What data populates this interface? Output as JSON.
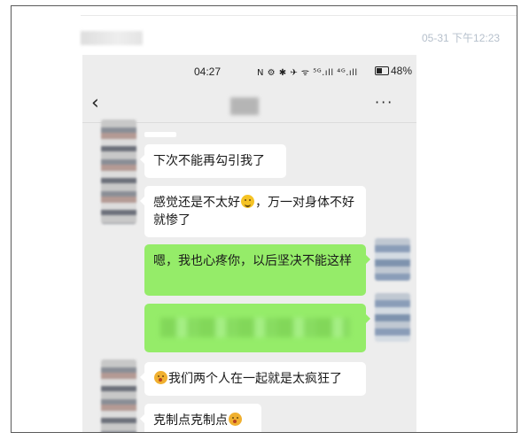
{
  "post": {
    "time": "05-31 下午12:23"
  },
  "phone": {
    "status_time": "04:27",
    "status_icons": "N ⚙ ✱ ✈ ᯤ ⁵ᴳ.ıll ⁴ᴳ.ıll",
    "battery": "48%"
  },
  "nav": {
    "back": "‹",
    "more": "···"
  },
  "messages": [
    {
      "side": "in",
      "text": "下次不能再勾引我了"
    },
    {
      "side": "in",
      "text_before": "感觉还是不太好",
      "emoji": "grinning-sweat-emoji",
      "text_after": "，万一对身体不好就惨了"
    },
    {
      "side": "out",
      "text": "嗯，我也心疼你，以后坚决不能这样"
    },
    {
      "side": "out",
      "text": ""
    },
    {
      "side": "in",
      "emoji": "blushing-emoji",
      "text_after": "我们两个人在一起就是太疯狂了"
    },
    {
      "side": "in",
      "text_before": "克制点克制点",
      "emoji": "flushed-emoji"
    }
  ]
}
